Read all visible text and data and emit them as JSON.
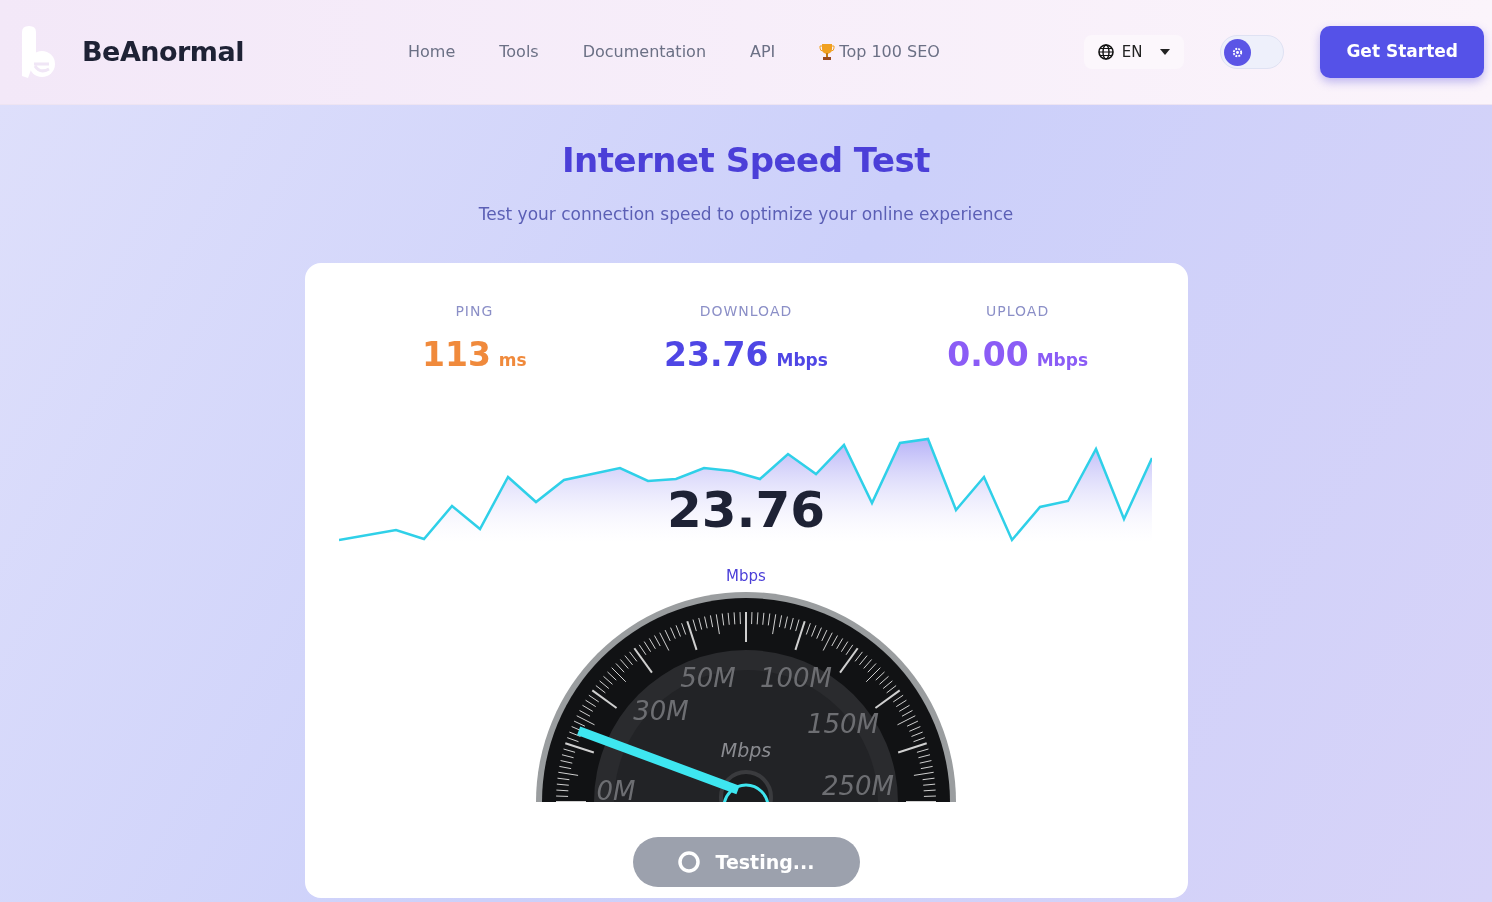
{
  "brand": {
    "name": "BeAnormal"
  },
  "nav": [
    {
      "label": "Home",
      "kind": "link"
    },
    {
      "label": "Tools",
      "kind": "link"
    },
    {
      "label": "Documentation",
      "kind": "link"
    },
    {
      "label": "API",
      "kind": "link"
    },
    {
      "label": "Top 100 SEO",
      "kind": "trophy"
    }
  ],
  "language": {
    "label": "EN"
  },
  "theme_toggle": {
    "on": false
  },
  "cta": {
    "label": "Get Started"
  },
  "hero": {
    "title": "Internet Speed Test",
    "subtitle": "Test your connection speed to optimize your online experience"
  },
  "stats": [
    {
      "label": "PING",
      "value": "113",
      "unit": "ms",
      "color": "#f08a3c"
    },
    {
      "label": "DOWNLOAD",
      "value": "23.76",
      "unit": "Mbps",
      "color": "#4f46e5"
    },
    {
      "label": "UPLOAD",
      "value": "0.00",
      "unit": "Mbps",
      "color": "#8b5cf6"
    }
  ],
  "current": {
    "value": "23.76",
    "unit": "Mbps"
  },
  "gauge": {
    "labels": [
      "0M",
      "30M",
      "50M",
      "100M",
      "150M",
      "250M"
    ],
    "unit": "Mbps",
    "level": 0.12
  },
  "action": {
    "label": "Testing...",
    "disabled": true
  }
}
